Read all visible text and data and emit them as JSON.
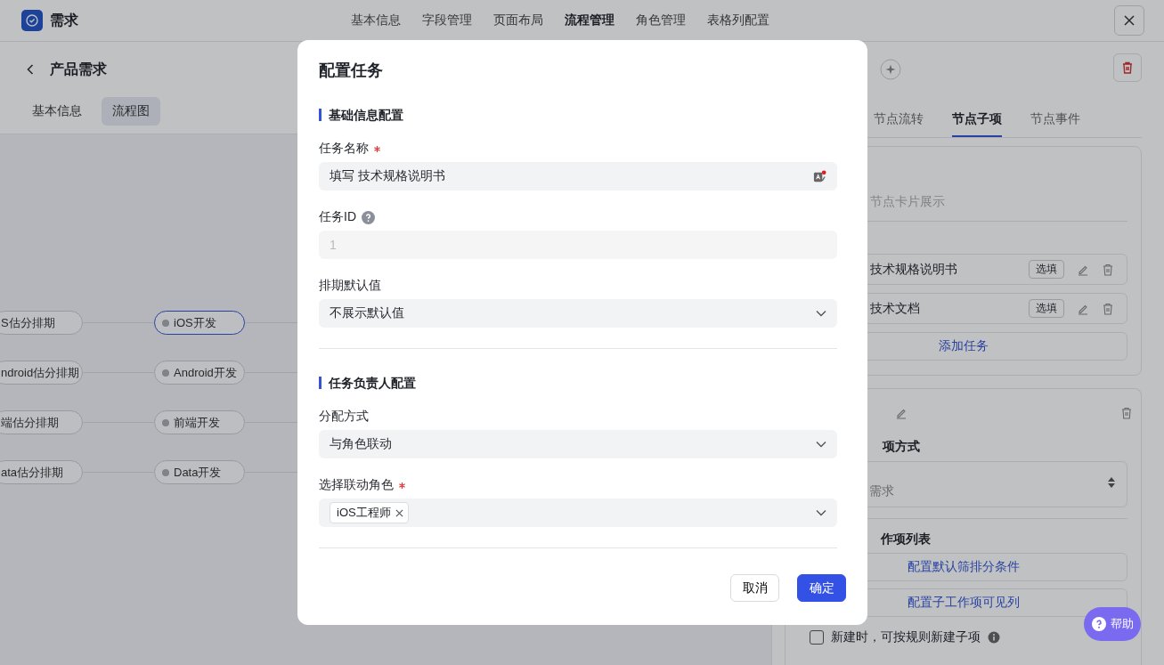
{
  "app": {
    "title": "需求"
  },
  "nav_tabs": [
    {
      "label": "基本信息",
      "selected": false
    },
    {
      "label": "字段管理",
      "selected": false
    },
    {
      "label": "页面布局",
      "selected": false
    },
    {
      "label": "流程管理",
      "selected": true
    },
    {
      "label": "角色管理",
      "selected": false
    },
    {
      "label": "表格列配置",
      "selected": false
    }
  ],
  "page": {
    "title": "产品需求",
    "tabs": [
      {
        "label": "基本信息",
        "selected": false
      },
      {
        "label": "流程图",
        "selected": true
      }
    ]
  },
  "flow_rows": [
    {
      "from": {
        "label": "S估分排期",
        "selected": false
      },
      "to": {
        "label": "iOS开发",
        "selected": true
      }
    },
    {
      "from": {
        "label": "ndroid估分排期",
        "selected": false
      },
      "to": {
        "label": "Android开发",
        "selected": false
      }
    },
    {
      "from": {
        "label": "端估分排期",
        "selected": false
      },
      "to": {
        "label": "前端开发",
        "selected": false
      }
    },
    {
      "from": {
        "label": "ata估分排期",
        "selected": false
      },
      "to": {
        "label": "Data开发",
        "selected": false
      }
    }
  ],
  "node_panel": {
    "tabs": [
      {
        "label": "节点流转",
        "selected": false
      },
      {
        "label": "节点子项",
        "selected": true
      },
      {
        "label": "节点事件",
        "selected": false
      }
    ],
    "hint": "节点卡片展示",
    "tasks": [
      {
        "name": "技术规格说明书",
        "tag": "选填"
      },
      {
        "name": "技术文档",
        "tag": "选填"
      }
    ],
    "add_task": "添加任务",
    "method_label": "项方式",
    "method_value": "需求",
    "list_label": "作项列表",
    "list_buttons": [
      "配置默认筛排分条件",
      "配置子工作项可见列"
    ],
    "checkbox": {
      "label": "新建时，可按规则新建子项",
      "checked": false
    }
  },
  "dialog": {
    "title": "配置任务",
    "sections": [
      {
        "title": "基础信息配置",
        "fields": [
          {
            "label": "任务名称",
            "kind": "text",
            "required": true,
            "help": false,
            "value": "填写 技术规格说明书"
          },
          {
            "label": "任务ID",
            "kind": "readonly",
            "required": false,
            "help": true,
            "value": "1"
          },
          {
            "label": "排期默认值",
            "kind": "select",
            "required": false,
            "help": false,
            "value": "不展示默认值"
          }
        ]
      },
      {
        "title": "任务负责人配置",
        "fields": [
          {
            "label": "分配方式",
            "kind": "select",
            "required": false,
            "help": false,
            "value": "与角色联动"
          },
          {
            "label": "选择联动角色",
            "kind": "tags",
            "required": true,
            "help": false,
            "tags": [
              "iOS工程师"
            ]
          }
        ]
      }
    ],
    "buttons": [
      {
        "label": "取消",
        "kind": "secondary"
      },
      {
        "label": "确定",
        "kind": "primary"
      }
    ]
  },
  "help_button": "帮助"
}
